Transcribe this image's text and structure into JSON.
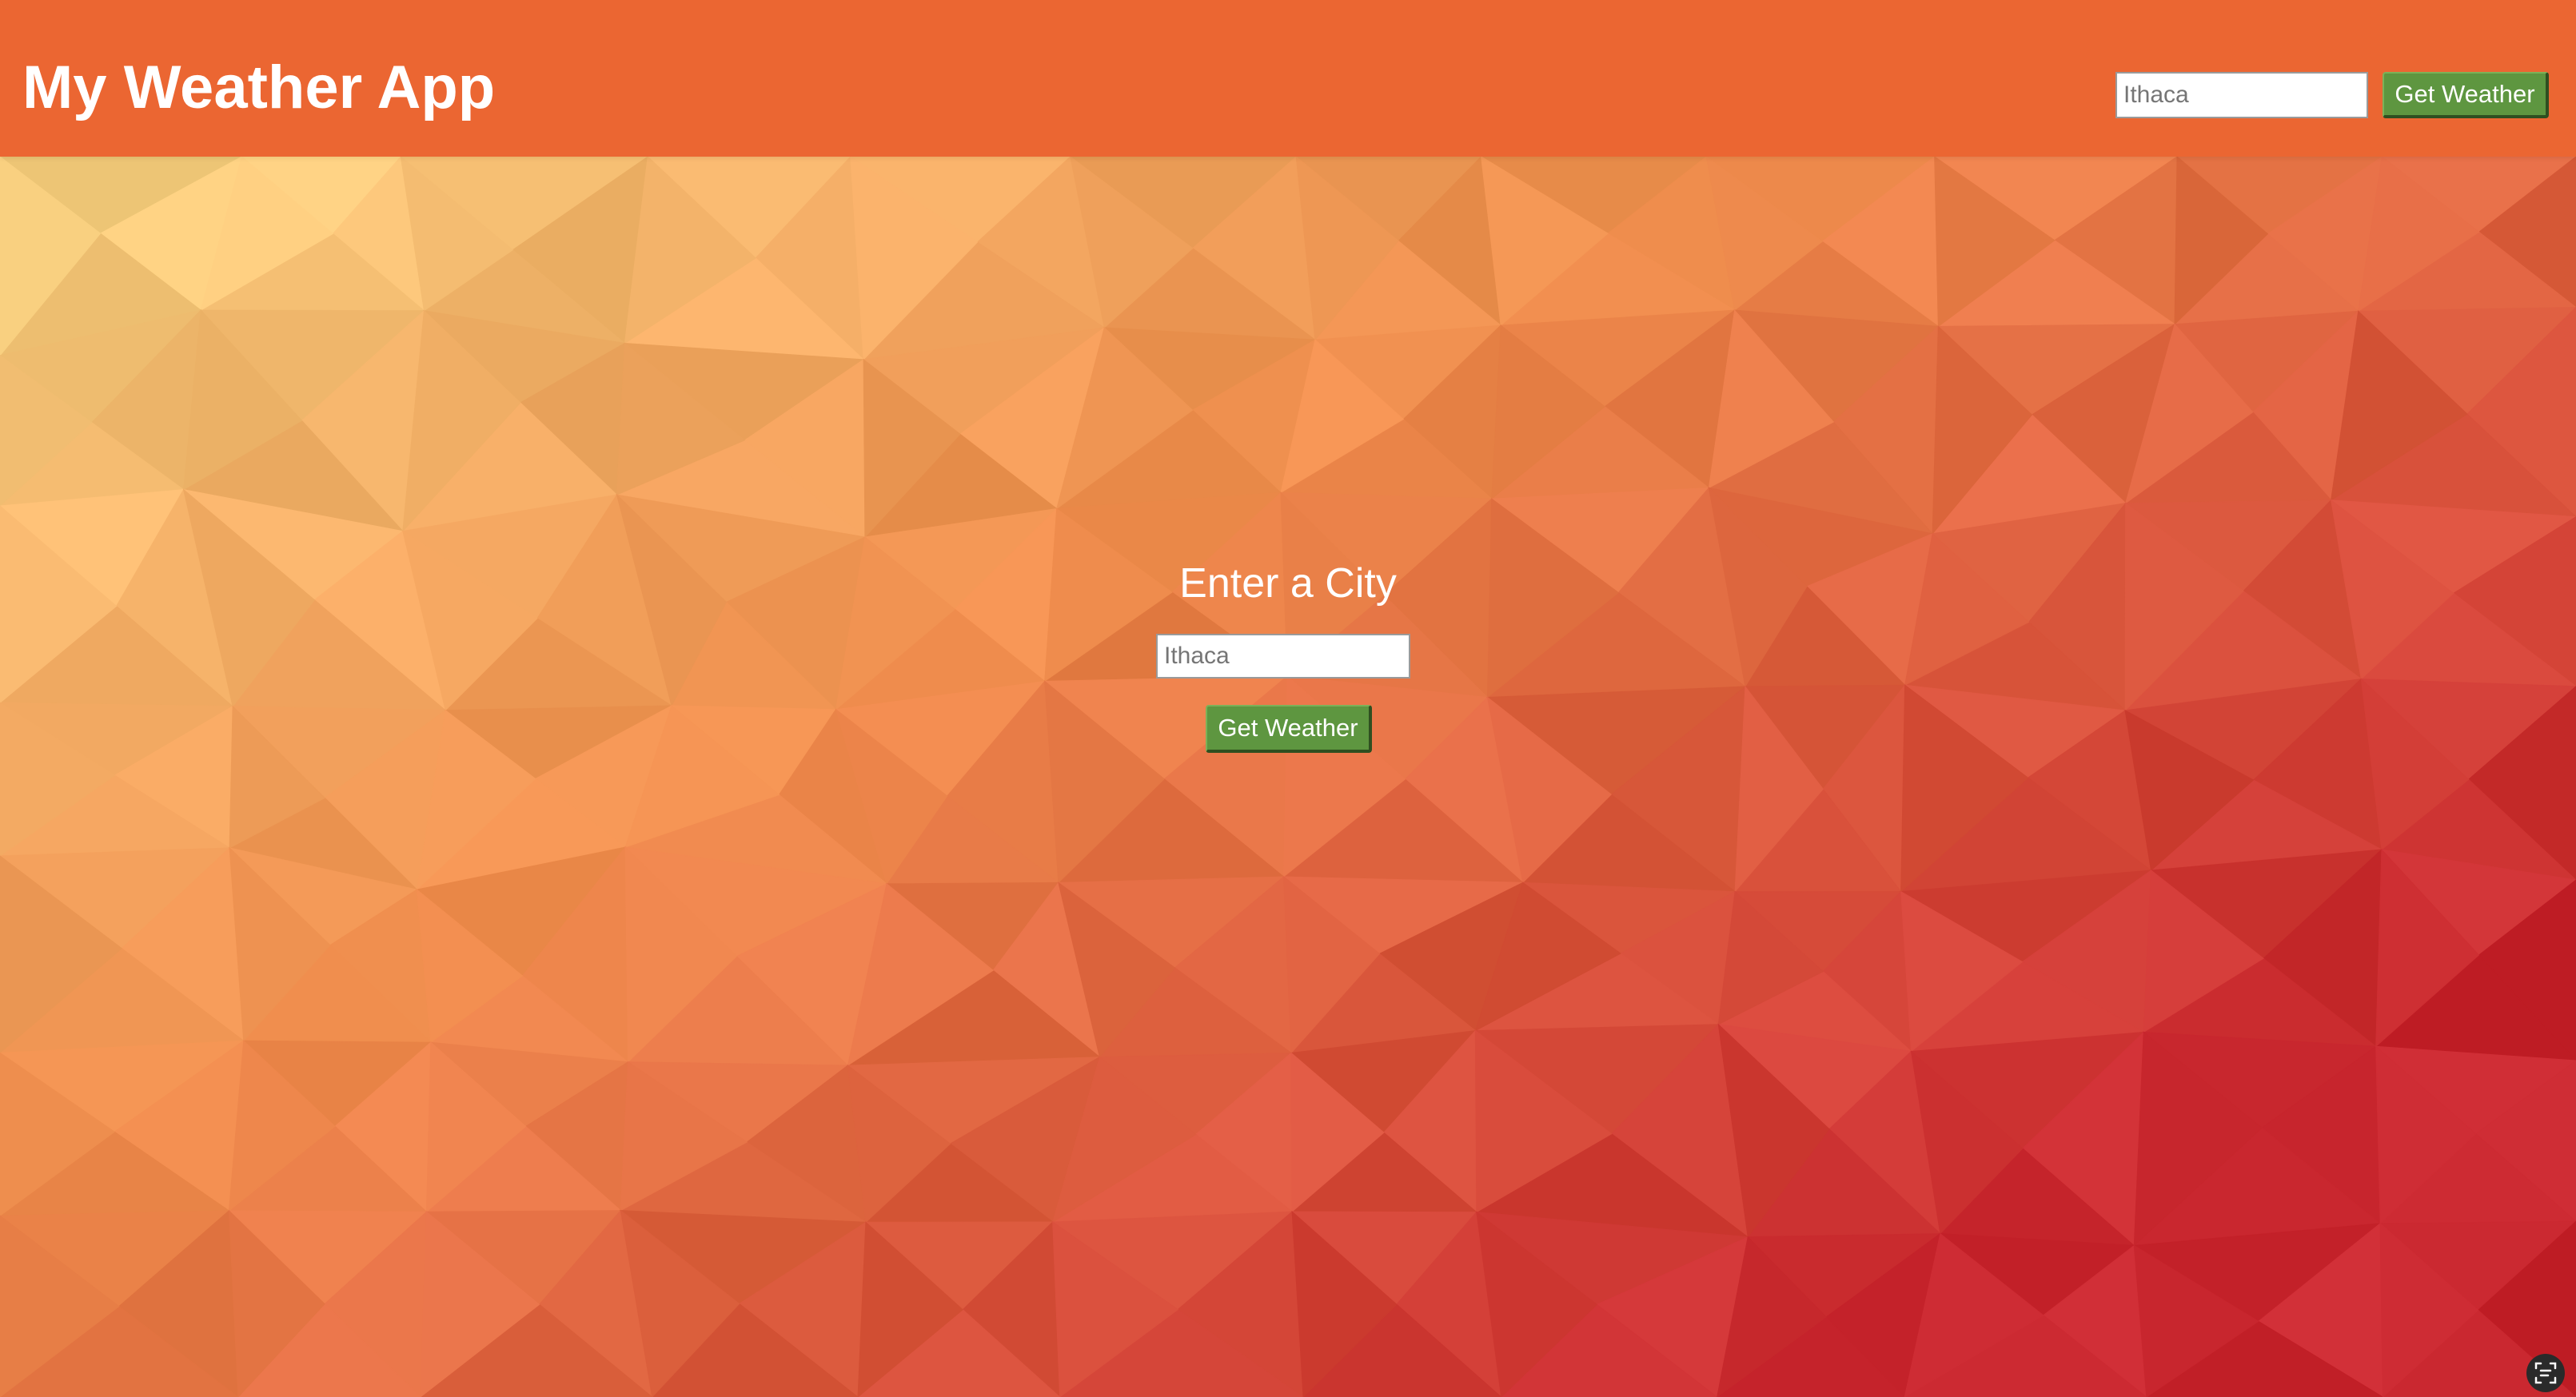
{
  "header": {
    "title": "My Weather App",
    "search_placeholder": "Ithaca",
    "button_label": "Get Weather"
  },
  "main": {
    "heading": "Enter a City",
    "search_placeholder": "Ithaca",
    "button_label": "Get Weather"
  },
  "icons": {
    "corner": "scan-text-icon"
  },
  "colors": {
    "header_bg": "#eb6632",
    "button_bg": "#5e9640",
    "bg_light": "#fbe08e",
    "bg_dark": "#c8262e"
  }
}
